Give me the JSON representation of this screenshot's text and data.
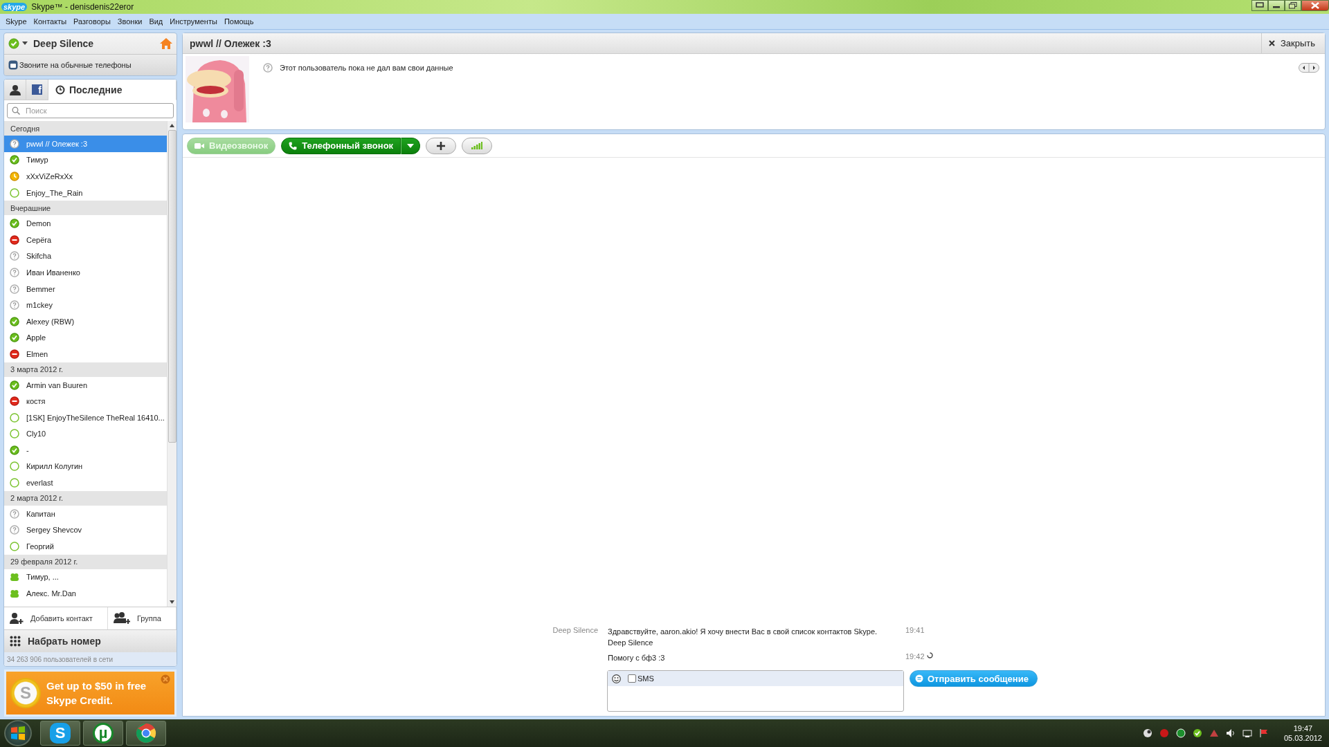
{
  "window": {
    "logo": "skype",
    "title": "Skype™ - denisdenis22eror"
  },
  "menu": [
    "Skype",
    "Контакты",
    "Разговоры",
    "Звонки",
    "Вид",
    "Инструменты",
    "Помощь"
  ],
  "profile": {
    "name": "Deep Silence",
    "kind": "online"
  },
  "call_phones": "Звоните на обычные телефоны",
  "tabs": [
    {
      "kind": "contacts",
      "selected": false
    },
    {
      "kind": "facebook",
      "glyph": "f",
      "selected": false
    },
    {
      "kind": "recent",
      "label": "Последние",
      "selected": true
    }
  ],
  "search": {
    "placeholder": "Поиск"
  },
  "contact_groups": [
    {
      "title": "Сегодня",
      "contacts": [
        {
          "name": "pwwl // Олежек :3",
          "kind": "unknown",
          "selected": true
        },
        {
          "name": "Тимур",
          "kind": "online",
          "selected": false
        },
        {
          "name": "xXxViZeRxXx",
          "kind": "away",
          "selected": false
        },
        {
          "name": "Enjoy_The_Rain",
          "kind": "offline",
          "selected": false
        }
      ]
    },
    {
      "title": "Вчерашние",
      "contacts": [
        {
          "name": "Demon",
          "kind": "online",
          "selected": false
        },
        {
          "name": "Серёга",
          "kind": "dnd",
          "selected": false
        },
        {
          "name": "Skifcha",
          "kind": "unknown",
          "selected": false
        },
        {
          "name": "Иван Иваненко",
          "kind": "unknown",
          "selected": false
        },
        {
          "name": "Bemmer",
          "kind": "unknown",
          "selected": false
        },
        {
          "name": "m1ckey",
          "kind": "unknown",
          "selected": false
        },
        {
          "name": "Alexey (RBW)",
          "kind": "online",
          "selected": false
        },
        {
          "name": "Apple",
          "kind": "online",
          "selected": false
        },
        {
          "name": "Elmen",
          "kind": "dnd",
          "selected": false
        }
      ]
    },
    {
      "title": "3 марта 2012 г.",
      "contacts": [
        {
          "name": "Armin van Buuren",
          "kind": "online",
          "selected": false
        },
        {
          "name": "костя",
          "kind": "dnd",
          "selected": false
        },
        {
          "name": "[1SK] EnjoyTheSilence TheReal 16410...",
          "kind": "offline",
          "selected": false
        },
        {
          "name": "Cly10",
          "kind": "offline",
          "selected": false
        },
        {
          "name": "-",
          "kind": "online",
          "selected": false
        },
        {
          "name": "Кирилл Колугин",
          "kind": "offline",
          "selected": false
        },
        {
          "name": "everlast",
          "kind": "offline",
          "selected": false
        }
      ]
    },
    {
      "title": "2 марта 2012 г.",
      "contacts": [
        {
          "name": "Капитан",
          "kind": "unknown",
          "selected": false
        },
        {
          "name": "Sergey Shevcov",
          "kind": "unknown",
          "selected": false
        },
        {
          "name": "Георгий",
          "kind": "offline",
          "selected": false
        }
      ]
    },
    {
      "title": "29 февраля 2012 г.",
      "contacts": [
        {
          "name": "Тимур, ...",
          "kind": "group",
          "selected": false
        },
        {
          "name": "Алекс. Mr.Dan",
          "kind": "group",
          "selected": false
        }
      ]
    }
  ],
  "contact_actions": [
    {
      "kind": "add",
      "label": "Добавить контакт"
    },
    {
      "kind": "group",
      "label": "Группа"
    }
  ],
  "dial": "Набрать номер",
  "online_count": "34 263 906 пользователей в сети",
  "promo": {
    "coin": "S",
    "text": "Get up to $50 in free Skype Credit."
  },
  "chat": {
    "title": "pwwl // Олежек :3",
    "close": "Закрыть",
    "info": "Этот пользователь пока не дал вам свои данные"
  },
  "toolbar": {
    "video": {
      "label": "Видеозвонок",
      "disabled": true
    },
    "call": "Телефонный звонок"
  },
  "messages": [
    {
      "author": "Deep Silence",
      "lines": [
        "Здравствуйте, aaron.akio! Я хочу внести Вас в свой список контактов Skype.",
        "Deep Silence"
      ],
      "time": "19:41",
      "pending": false
    },
    {
      "lines": [
        "Помогу с бф3 :3"
      ],
      "time": "19:42",
      "pending": true
    }
  ],
  "composer": {
    "sms_label": "SMS",
    "sms_checked": false
  },
  "send": "Отправить сообщение",
  "taskbar": {
    "apps": [
      {
        "kind": "skype",
        "glyph": "S"
      },
      {
        "kind": "utorrent",
        "glyph": "µ"
      },
      {
        "kind": "chrome"
      }
    ],
    "time": "19:47",
    "date": "05.03.2012"
  }
}
